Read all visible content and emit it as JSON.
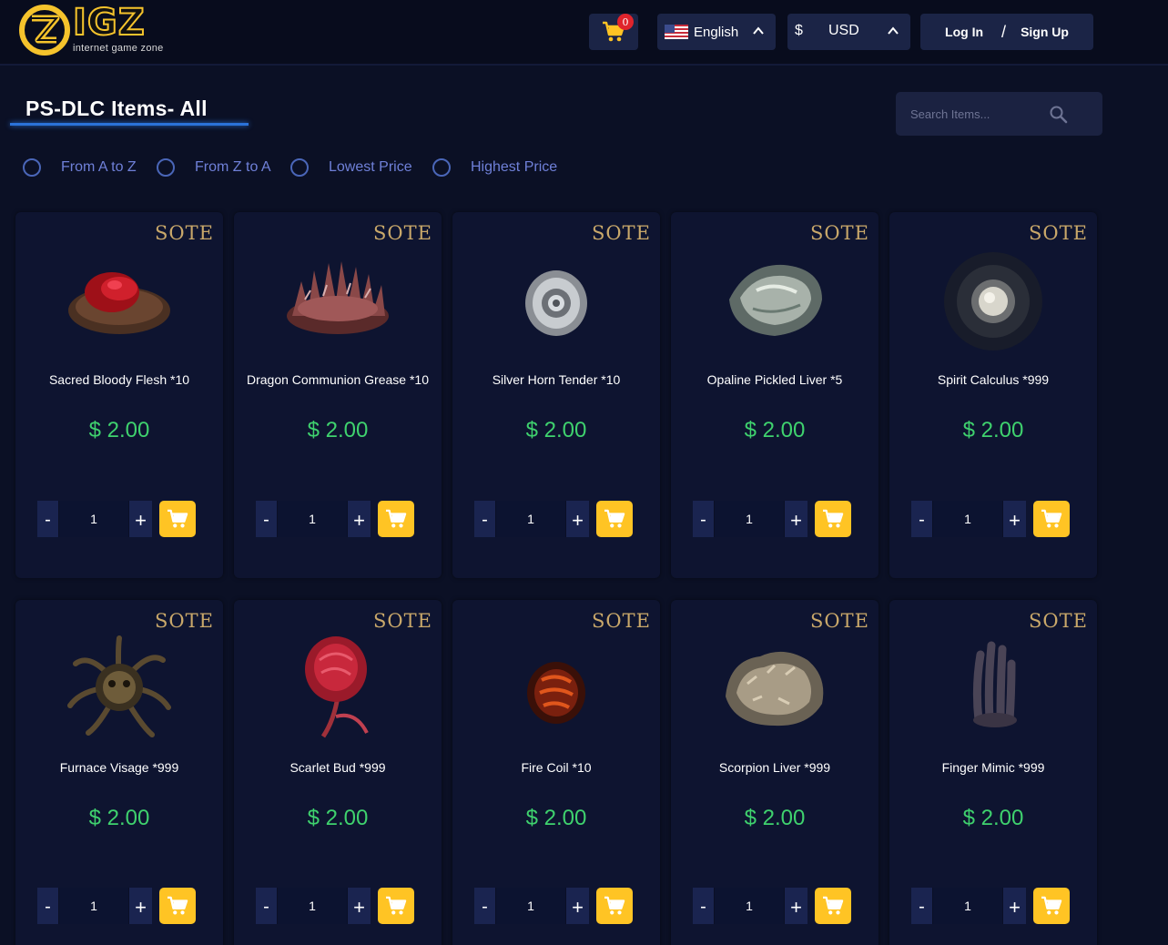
{
  "header": {
    "logo_word": "IGZ",
    "logo_tagline": "internet game zone",
    "cart_count": "0",
    "language": "English",
    "currency_symbol": "$",
    "currency": "USD",
    "login_label": "Log In",
    "auth_separator": "/",
    "signup_label": "Sign Up"
  },
  "page": {
    "title": "PS-DLC Items- All",
    "search_placeholder": "Search Items..."
  },
  "sort_options": [
    {
      "label": "From A to Z"
    },
    {
      "label": "From Z to A"
    },
    {
      "label": "Lowest Price"
    },
    {
      "label": "Highest Price"
    }
  ],
  "products": [
    {
      "badge": "SOTE",
      "name": "Sacred Bloody Flesh *10",
      "price": "$ 2.00",
      "qty": "1",
      "icon": "bloody-flesh-icon"
    },
    {
      "badge": "SOTE",
      "name": "Dragon Communion Grease *10",
      "price": "$ 2.00",
      "qty": "1",
      "icon": "dragon-grease-icon"
    },
    {
      "badge": "SOTE",
      "name": "Silver Horn Tender *10",
      "price": "$ 2.00",
      "qty": "1",
      "icon": "silver-horn-icon"
    },
    {
      "badge": "SOTE",
      "name": "Opaline Pickled Liver *5",
      "price": "$ 2.00",
      "qty": "1",
      "icon": "opaline-liver-icon"
    },
    {
      "badge": "SOTE",
      "name": "Spirit Calculus *999",
      "price": "$ 2.00",
      "qty": "1",
      "icon": "spirit-calculus-icon"
    },
    {
      "badge": "SOTE",
      "name": "Furnace Visage *999",
      "price": "$ 2.00",
      "qty": "1",
      "icon": "furnace-visage-icon"
    },
    {
      "badge": "SOTE",
      "name": "Scarlet Bud *999",
      "price": "$ 2.00",
      "qty": "1",
      "icon": "scarlet-bud-icon"
    },
    {
      "badge": "SOTE",
      "name": "Fire Coil *10",
      "price": "$ 2.00",
      "qty": "1",
      "icon": "fire-coil-icon"
    },
    {
      "badge": "SOTE",
      "name": "Scorpion Liver *999",
      "price": "$ 2.00",
      "qty": "1",
      "icon": "scorpion-liver-icon"
    },
    {
      "badge": "SOTE",
      "name": "Finger Mimic *999",
      "price": "$ 2.00",
      "qty": "1",
      "icon": "finger-mimic-icon"
    }
  ],
  "colors": {
    "background": "#0b1025",
    "card": "#0e1430",
    "accent_yellow": "#ffc424",
    "price_green": "#3fd26e",
    "sort_label": "#6f80d8",
    "badge_gold": "#c9a86a"
  }
}
